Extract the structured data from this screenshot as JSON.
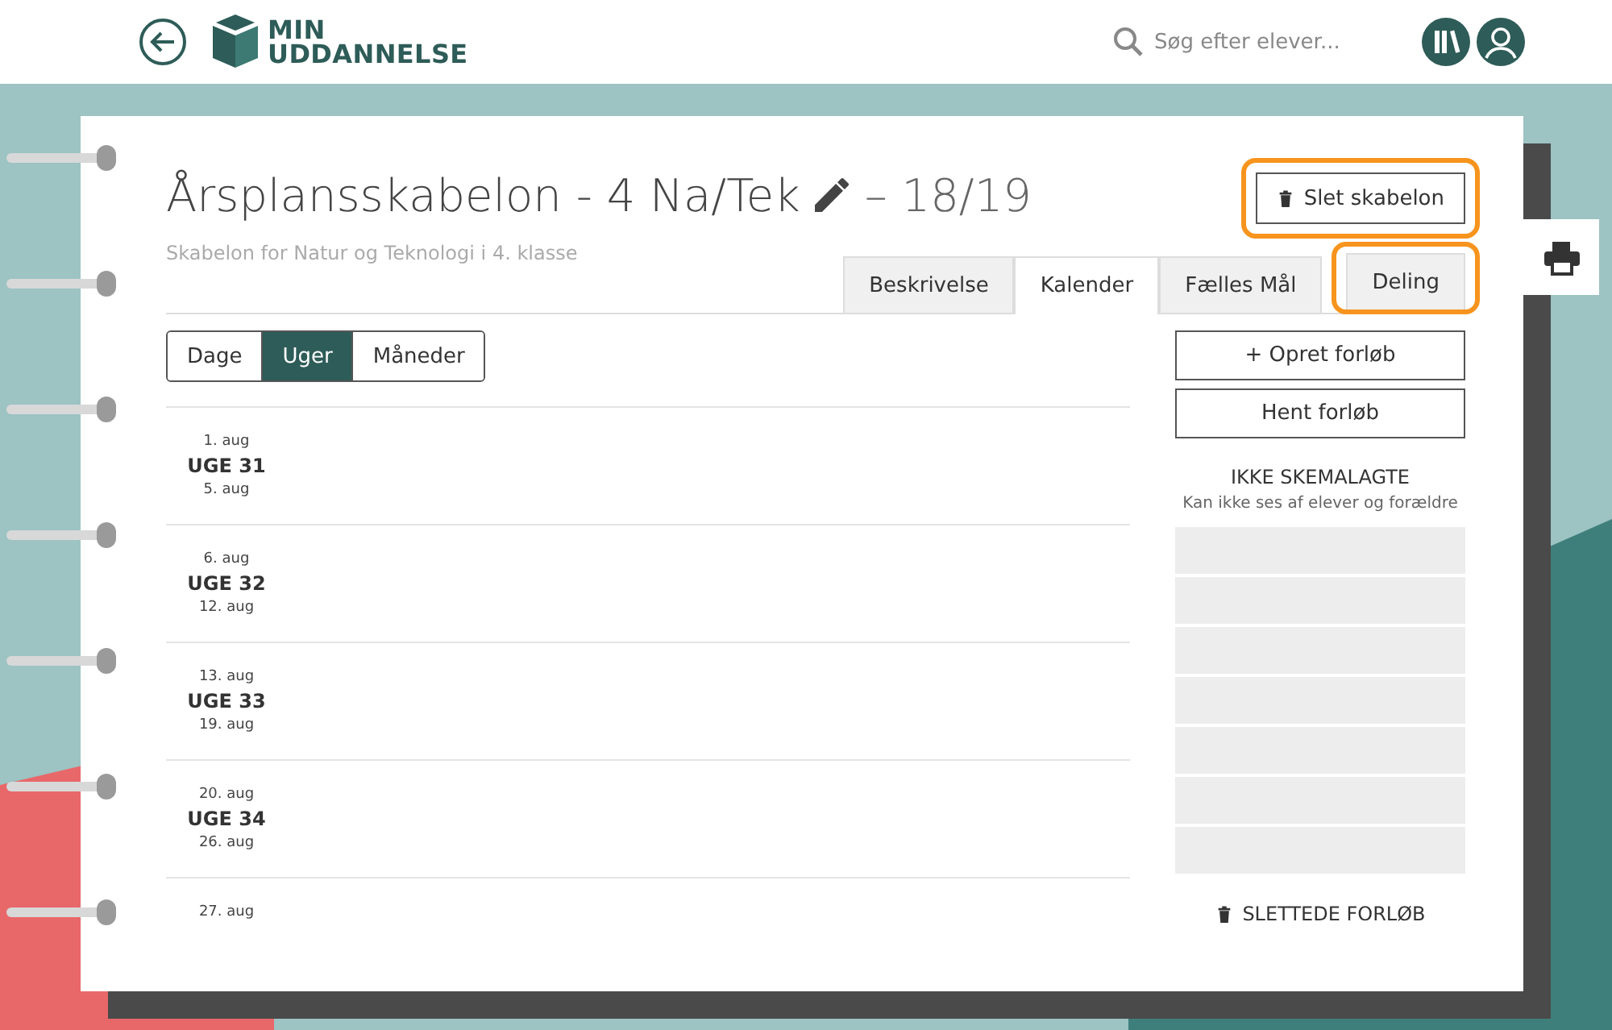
{
  "header": {
    "logo": [
      "MIN",
      "UDDANNELSE"
    ],
    "search": {
      "placeholder": "Søg efter elever..."
    }
  },
  "page": {
    "title": "Årsplansskabelon - 4 Na/Tek",
    "title_suffix": "– 18/19",
    "subtitle": "Skabelon for Natur og Teknologi i 4. klasse",
    "delete_button": {
      "label": "Slet skabelon",
      "highlighted": true
    },
    "tabs": [
      {
        "label": "Beskrivelse",
        "selected": false,
        "highlighted": false
      },
      {
        "label": "Kalender",
        "selected": true,
        "highlighted": false
      },
      {
        "label": "Fælles Mål",
        "selected": false,
        "highlighted": false
      },
      {
        "label": "Deling",
        "selected": false,
        "highlighted": true
      }
    ],
    "view_toggle": [
      {
        "label": "Dage",
        "selected": false
      },
      {
        "label": "Uger",
        "selected": true
      },
      {
        "label": "Måneder",
        "selected": false
      }
    ],
    "weeks": [
      {
        "start": "1. aug",
        "week": "UGE 31",
        "end": "5. aug"
      },
      {
        "start": "6. aug",
        "week": "UGE 32",
        "end": "12. aug"
      },
      {
        "start": "13. aug",
        "week": "UGE 33",
        "end": "19. aug"
      },
      {
        "start": "20. aug",
        "week": "UGE 34",
        "end": "26. aug"
      },
      {
        "start": "27. aug"
      }
    ],
    "actions": [
      "+ Opret forløb",
      "Hent forløb"
    ],
    "unscheduled": {
      "title": "IKKE SKEMALAGTE",
      "note": "Kan ikke ses af elever og forældre"
    },
    "deleted_link": "SLETTEDE FORLØB"
  }
}
